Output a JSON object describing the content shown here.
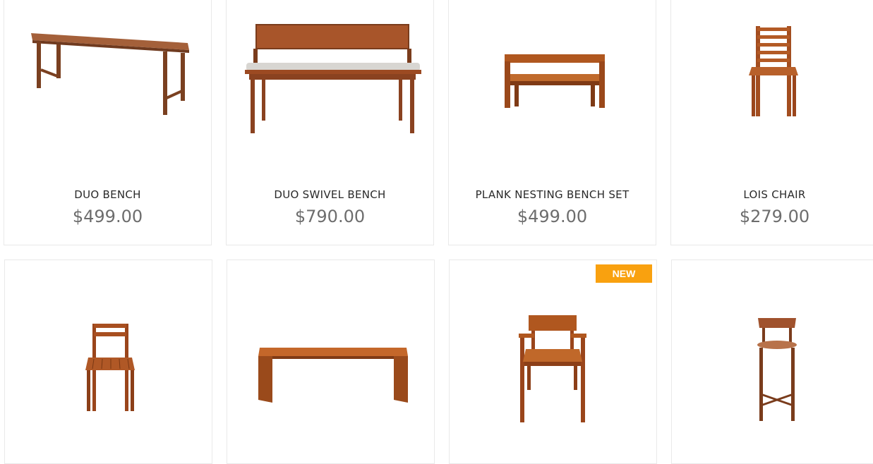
{
  "products": [
    {
      "name": "DUO BENCH",
      "price": "$499.00",
      "image": "bench-image"
    },
    {
      "name": "DUO SWIVEL BENCH",
      "price": "$790.00",
      "image": "bench-with-back-image"
    },
    {
      "name": "PLANK NESTING BENCH SET",
      "price": "$499.00",
      "image": "nesting-bench-image"
    },
    {
      "name": "LOIS CHAIR",
      "price": "$279.00",
      "image": "chair-image"
    },
    {
      "name": "",
      "price": "",
      "image": "chair-image"
    },
    {
      "name": "",
      "price": "",
      "image": "bench-image"
    },
    {
      "name": "",
      "price": "",
      "image": "armchair-image",
      "badge": "NEW"
    },
    {
      "name": "",
      "price": "",
      "image": "bar-stool-image"
    }
  ],
  "colors": {
    "wood": "#a0522d",
    "wood_dark": "#7a3c1c",
    "badge": "#f9a10f",
    "price": "#6d6d6d"
  }
}
